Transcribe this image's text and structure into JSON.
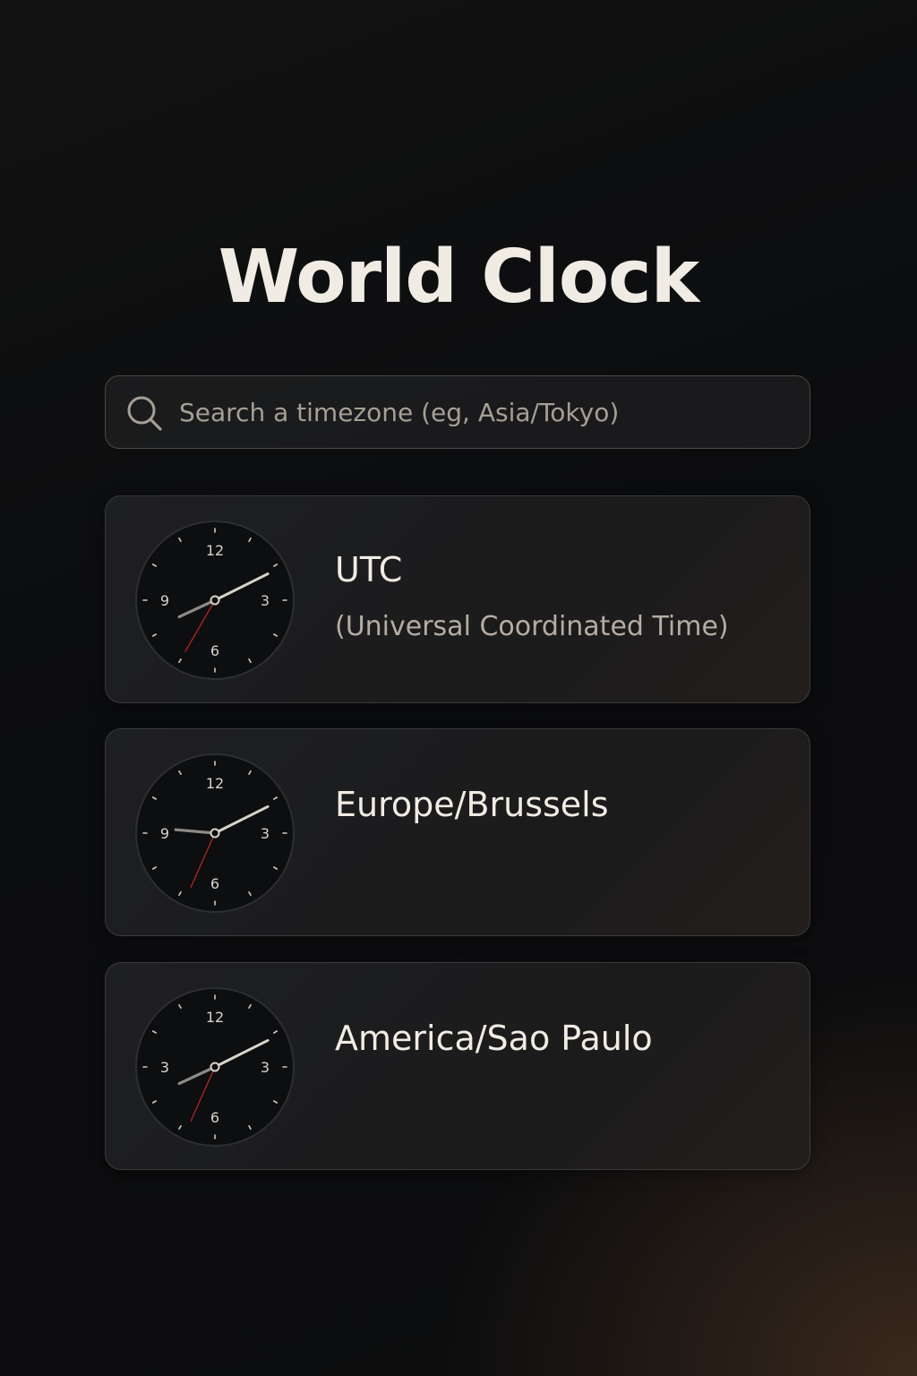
{
  "header": {
    "title": "World Clock"
  },
  "search": {
    "placeholder": "Search a timezone (eg, Asia/Tokyo)",
    "value": ""
  },
  "clocks": [
    {
      "name": "UTC",
      "description": "(Universal Coordinated Time)",
      "numerals": [
        "12",
        "3",
        "6",
        "9"
      ],
      "time": {
        "hour": 8,
        "minute": 10,
        "second": 35
      }
    },
    {
      "name": "Europe/Brussels",
      "description": "",
      "numerals": [
        "12",
        "3",
        "6",
        "9"
      ],
      "time": {
        "hour": 9,
        "minute": 10,
        "second": 34
      }
    },
    {
      "name": "America/Sao Paulo",
      "description": "",
      "numerals": [
        "12",
        "3",
        "6",
        "3"
      ],
      "time": {
        "hour": 8,
        "minute": 10,
        "second": 34
      }
    }
  ],
  "colors": {
    "hour_hand": "#8f8a84",
    "minute_hand": "#d9d3c8",
    "second_hand": "#b3261e",
    "face": "#0d0e10",
    "numeral": "#d9d3c8"
  }
}
